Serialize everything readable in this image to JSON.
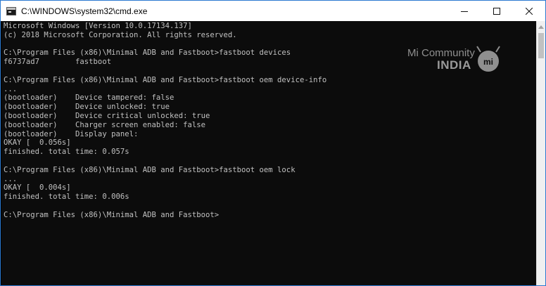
{
  "window": {
    "title": "C:\\WINDOWS\\system32\\cmd.exe",
    "icon": "cmd-console-icon",
    "controls": {
      "minimize": "minimize-icon",
      "maximize": "maximize-icon",
      "close": "close-icon"
    }
  },
  "console": {
    "lines": [
      "Microsoft Windows [Version 10.0.17134.137]",
      "(c) 2018 Microsoft Corporation. All rights reserved.",
      "",
      "C:\\Program Files (x86)\\Minimal ADB and Fastboot>fastboot devices",
      "f6737ad7        fastboot",
      "",
      "C:\\Program Files (x86)\\Minimal ADB and Fastboot>fastboot oem device-info",
      "...",
      "(bootloader)    Device tampered: false",
      "(bootloader)    Device unlocked: true",
      "(bootloader)    Device critical unlocked: true",
      "(bootloader)    Charger screen enabled: false",
      "(bootloader)    Display panel:",
      "OKAY [  0.056s]",
      "finished. total time: 0.057s",
      "",
      "C:\\Program Files (x86)\\Minimal ADB and Fastboot>fastboot oem lock",
      "...",
      "OKAY [  0.004s]",
      "finished. total time: 0.006s",
      "",
      "C:\\Program Files (x86)\\Minimal ADB and Fastboot>"
    ]
  },
  "watermark": {
    "line1": "Mi Community",
    "line2": "INDIA",
    "logo_text": "mi"
  },
  "colors": {
    "console_bg": "#0c0c0c",
    "console_text": "#c0c0c0",
    "border": "#2b79d1"
  }
}
